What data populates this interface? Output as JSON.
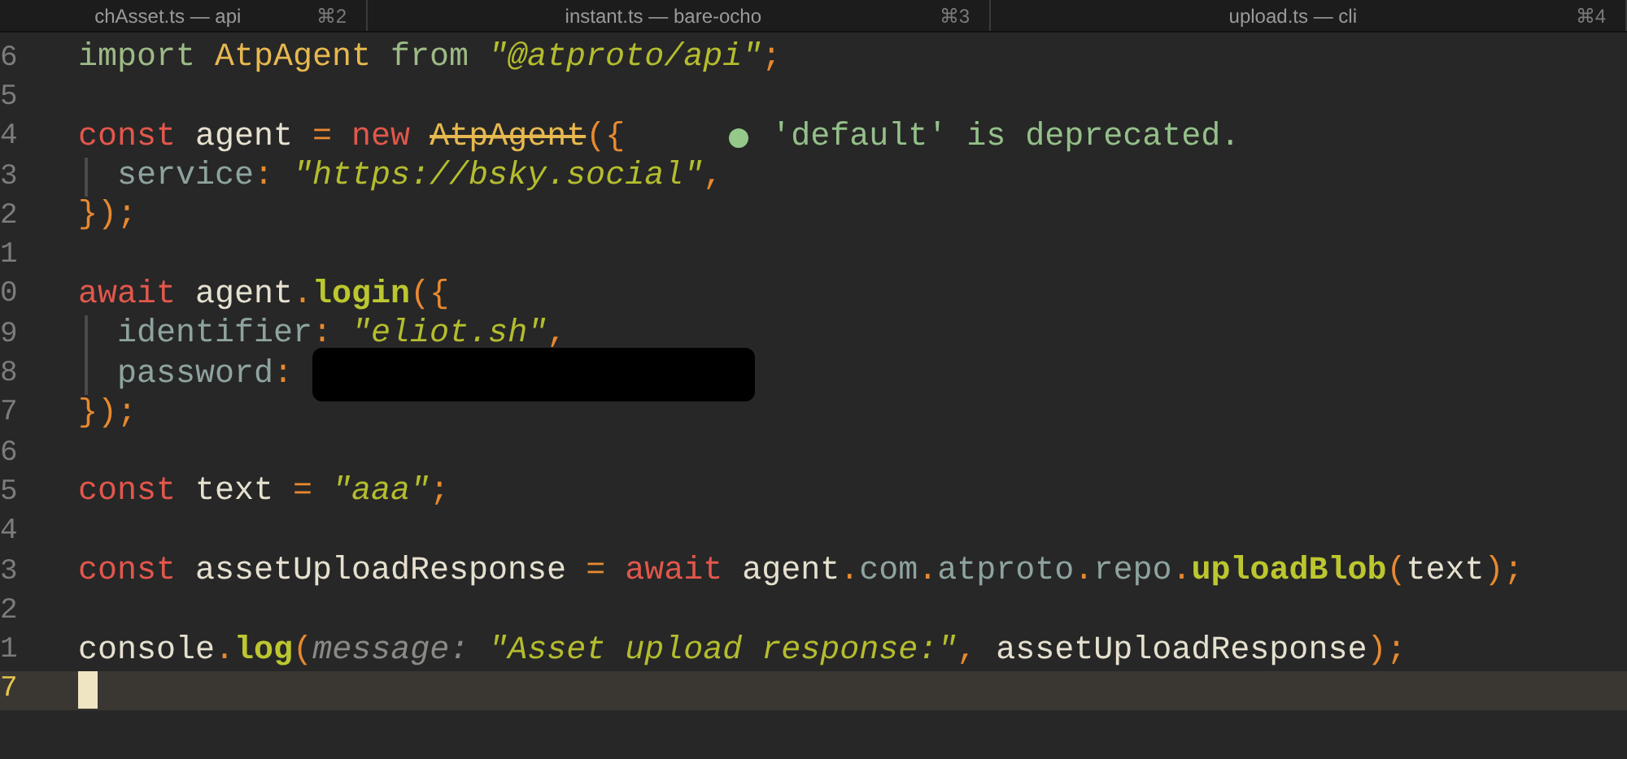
{
  "tabs": [
    {
      "title": "chAsset.ts — api",
      "shortcut": "⌘2"
    },
    {
      "title": "instant.ts — bare-ocho",
      "shortcut": "⌘3"
    },
    {
      "title": "upload.ts — cli",
      "shortcut": "⌘4"
    }
  ],
  "lines": [
    {
      "number": "6",
      "current": false,
      "indent": false,
      "tokens": [
        {
          "kind": "import",
          "text": "import "
        },
        {
          "kind": "type",
          "text": "AtpAgent"
        },
        {
          "kind": "import",
          "text": " from "
        },
        {
          "kind": "string",
          "text": "\"@atproto/api\""
        },
        {
          "kind": "punct",
          "text": ";"
        }
      ]
    },
    {
      "number": "5",
      "current": false,
      "indent": false
    },
    {
      "number": "4",
      "current": false,
      "indent": false,
      "tokens": [
        {
          "kind": "keyword",
          "text": "const"
        },
        {
          "kind": "plain",
          "text": " agent "
        },
        {
          "kind": "punct",
          "text": "= "
        },
        {
          "kind": "keyword",
          "text": "new "
        },
        {
          "kind": "deprecated",
          "text": "AtpAgent"
        },
        {
          "kind": "punct",
          "text": "({"
        }
      ],
      "diagnostic": {
        "message": "'default' is deprecated."
      }
    },
    {
      "number": "3",
      "current": false,
      "indent": true,
      "tokens": [
        {
          "kind": "prop",
          "text": "service"
        },
        {
          "kind": "punct",
          "text": ": "
        },
        {
          "kind": "string",
          "text": "\"https://bsky.social\""
        },
        {
          "kind": "punct",
          "text": ","
        }
      ]
    },
    {
      "number": "2",
      "current": false,
      "indent": false,
      "tokens": [
        {
          "kind": "punct",
          "text": "});"
        }
      ]
    },
    {
      "number": "1",
      "current": false,
      "indent": false
    },
    {
      "number": "0",
      "current": false,
      "indent": false,
      "tokens": [
        {
          "kind": "keyword",
          "text": "await"
        },
        {
          "kind": "plain",
          "text": " agent"
        },
        {
          "kind": "punct",
          "text": "."
        },
        {
          "kind": "func",
          "text": "login"
        },
        {
          "kind": "punct",
          "text": "({"
        }
      ]
    },
    {
      "number": "9",
      "current": false,
      "indent": true,
      "tokens": [
        {
          "kind": "prop",
          "text": "identifier"
        },
        {
          "kind": "punct",
          "text": ": "
        },
        {
          "kind": "string",
          "text": "\"eliot.sh\""
        },
        {
          "kind": "punct",
          "text": ","
        }
      ]
    },
    {
      "number": "8",
      "current": false,
      "indent": true,
      "redacted": true,
      "tokens": [
        {
          "kind": "prop",
          "text": "password"
        },
        {
          "kind": "punct",
          "text": ":"
        }
      ]
    },
    {
      "number": "7",
      "current": false,
      "indent": false,
      "tokens": [
        {
          "kind": "punct",
          "text": "});"
        }
      ]
    },
    {
      "number": "6",
      "current": false,
      "indent": false
    },
    {
      "number": "5",
      "current": false,
      "indent": false,
      "tokens": [
        {
          "kind": "keyword",
          "text": "const"
        },
        {
          "kind": "plain",
          "text": " text "
        },
        {
          "kind": "punct",
          "text": "= "
        },
        {
          "kind": "string",
          "text": "\"aaa\""
        },
        {
          "kind": "punct",
          "text": ";"
        }
      ]
    },
    {
      "number": "4",
      "current": false,
      "indent": false
    },
    {
      "number": "3",
      "current": false,
      "indent": false,
      "tokens": [
        {
          "kind": "keyword",
          "text": "const"
        },
        {
          "kind": "plain",
          "text": " assetUploadResponse "
        },
        {
          "kind": "punct",
          "text": "= "
        },
        {
          "kind": "keyword",
          "text": "await"
        },
        {
          "kind": "plain",
          "text": " agent"
        },
        {
          "kind": "punct",
          "text": "."
        },
        {
          "kind": "prop",
          "text": "com"
        },
        {
          "kind": "punct",
          "text": "."
        },
        {
          "kind": "prop",
          "text": "atproto"
        },
        {
          "kind": "punct",
          "text": "."
        },
        {
          "kind": "prop",
          "text": "repo"
        },
        {
          "kind": "punct",
          "text": "."
        },
        {
          "kind": "func",
          "text": "uploadBlob"
        },
        {
          "kind": "punct",
          "text": "("
        },
        {
          "kind": "plain",
          "text": "text"
        },
        {
          "kind": "punct",
          "text": ");"
        }
      ]
    },
    {
      "number": "2",
      "current": false,
      "indent": false
    },
    {
      "number": "1",
      "current": false,
      "indent": false,
      "tokens": [
        {
          "kind": "plain",
          "text": "console"
        },
        {
          "kind": "punct",
          "text": "."
        },
        {
          "kind": "func",
          "text": "log"
        },
        {
          "kind": "punct",
          "text": "("
        },
        {
          "kind": "hint",
          "text": "message: "
        },
        {
          "kind": "string",
          "text": "\"Asset upload response:\""
        },
        {
          "kind": "punct",
          "text": ", "
        },
        {
          "kind": "plain",
          "text": "assetUploadResponse"
        },
        {
          "kind": "punct",
          "text": ");"
        }
      ]
    },
    {
      "number": "7",
      "current": true,
      "indent": false
    }
  ]
}
